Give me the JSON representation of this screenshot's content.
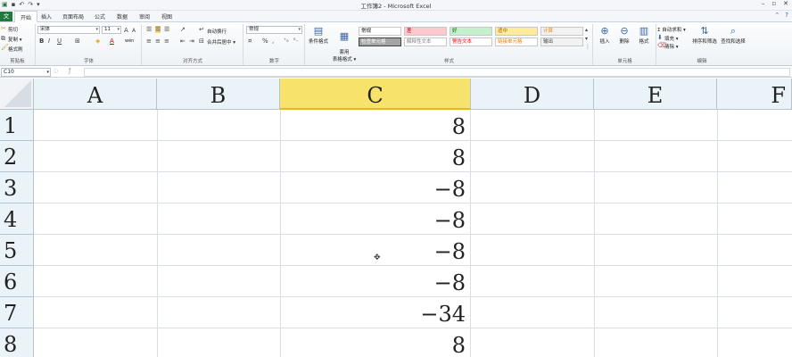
{
  "titlebar": {
    "title": "工作簿2 - Microsoft Excel",
    "qat_icons": [
      "excel-logo-icon",
      "save-icon",
      "undo-icon",
      "redo-icon",
      "customize-icon"
    ],
    "minimize": "–",
    "restore": "▫",
    "close": "✕"
  },
  "tabs": {
    "file": "文",
    "items": [
      "开始",
      "插入",
      "页面布局",
      "公式",
      "数据",
      "审阅",
      "视图"
    ],
    "active": "开始"
  },
  "ribbon": {
    "clipboard": {
      "cut": "剪切",
      "copy": "复制 ▾",
      "format_painter": "格式刷",
      "paste": "粘贴",
      "label": "剪贴板"
    },
    "font": {
      "font_name": "宋体",
      "font_size": "11",
      "grow": "A",
      "shrink": "A",
      "bold": "B",
      "italic": "I",
      "underline": "U",
      "font_color_letter": "A",
      "wen": "wén",
      "label": "字体"
    },
    "alignment": {
      "wrap": "自动换行",
      "merge": "合并后居中 ▾",
      "label": "对齐方式"
    },
    "number": {
      "format": "常规",
      "percent": "%",
      "comma": ",",
      "label": "数字"
    },
    "styles": {
      "conditional": "条件格式",
      "table_format": "套用\n表格格式 ▾",
      "cells": [
        {
          "text": "常规",
          "bg": "#ffffff",
          "fg": "#000000"
        },
        {
          "text": "差",
          "bg": "#ffc7ce",
          "fg": "#9c0006"
        },
        {
          "text": "好",
          "bg": "#c6efce",
          "fg": "#006100"
        },
        {
          "text": "适中",
          "bg": "#ffeb9c",
          "fg": "#9c6500"
        },
        {
          "text": "计算",
          "bg": "#f2f2f2",
          "fg": "#fa7d00"
        },
        {
          "text": "检查单元格",
          "bg": "#a5a5a5",
          "fg": "#ffffff"
        },
        {
          "text": "解释性文本",
          "bg": "#ffffff",
          "fg": "#7f7f7f"
        },
        {
          "text": "警告文本",
          "bg": "#ffffff",
          "fg": "#ff0000"
        },
        {
          "text": "链接单元格",
          "bg": "#ffffff",
          "fg": "#fa7d00"
        },
        {
          "text": "输出",
          "bg": "#f2f2f2",
          "fg": "#3f3f3f"
        }
      ],
      "label": "样式"
    },
    "cells": {
      "insert": "插入",
      "delete": "删除",
      "format": "格式",
      "label": "单元格"
    },
    "editing": {
      "autosum": "Σ 自动求和 ▾",
      "fill": "填充 ▾",
      "clear": "清除 ▾",
      "sort": "排序和筛选",
      "find": "查找和选择",
      "label": "编辑"
    }
  },
  "formula_bar": {
    "name_box": "C10",
    "formula": ""
  },
  "sheet": {
    "columns": [
      "A",
      "B",
      "C",
      "D",
      "E",
      "F"
    ],
    "selected_column": "C",
    "rows": [
      "1",
      "2",
      "3",
      "4",
      "5",
      "6",
      "7",
      "8"
    ],
    "column_c_values": [
      "8",
      "8",
      "−8",
      "−8",
      "−8",
      "−8",
      "−34",
      "8"
    ]
  }
}
